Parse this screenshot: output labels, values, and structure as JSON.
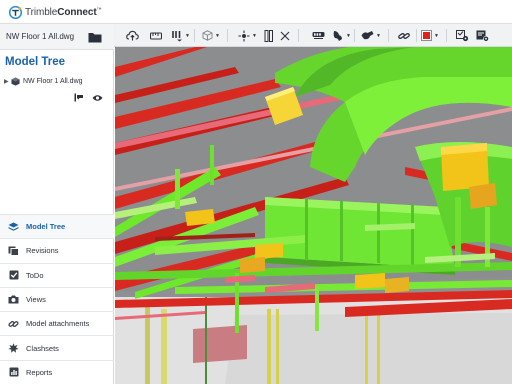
{
  "app": {
    "brand_prefix": "Trimble",
    "brand_suffix": "Connect",
    "trademark": "™"
  },
  "file": {
    "name": "NW Floor 1 All.dwg"
  },
  "model_tree": {
    "title": "Model Tree",
    "items": [
      {
        "label": "NW Floor 1 All.dwg",
        "expanded": false
      }
    ]
  },
  "nav": {
    "items": [
      {
        "label": "Model Tree",
        "icon": "layers-icon",
        "active": true
      },
      {
        "label": "Revisions",
        "icon": "revisions-icon",
        "active": false
      },
      {
        "label": "ToDo",
        "icon": "todo-icon",
        "active": false
      },
      {
        "label": "Views",
        "icon": "camera-icon",
        "active": false
      },
      {
        "label": "Model attachments",
        "icon": "link-icon",
        "active": false
      },
      {
        "label": "Clashsets",
        "icon": "clash-icon",
        "active": false
      },
      {
        "label": "Reports",
        "icon": "report-icon",
        "active": false
      }
    ]
  },
  "toolbar": {
    "tools": [
      "cloud-upload-icon",
      "measure-icon",
      "section-icon",
      "box-icon",
      "navigate-icon",
      "fit-icon",
      "clear-icon",
      "walk-icon",
      "markup-icon",
      "visibility-icon",
      "link-icon",
      "color-icon",
      "settings-icon",
      "model-settings-icon"
    ],
    "active_color": "#e0211b"
  },
  "colors": {
    "accent": "#1a62a8",
    "duct_green": "#6ee82a",
    "steel_red": "#e0211b",
    "equipment_yellow": "#f2c318"
  }
}
